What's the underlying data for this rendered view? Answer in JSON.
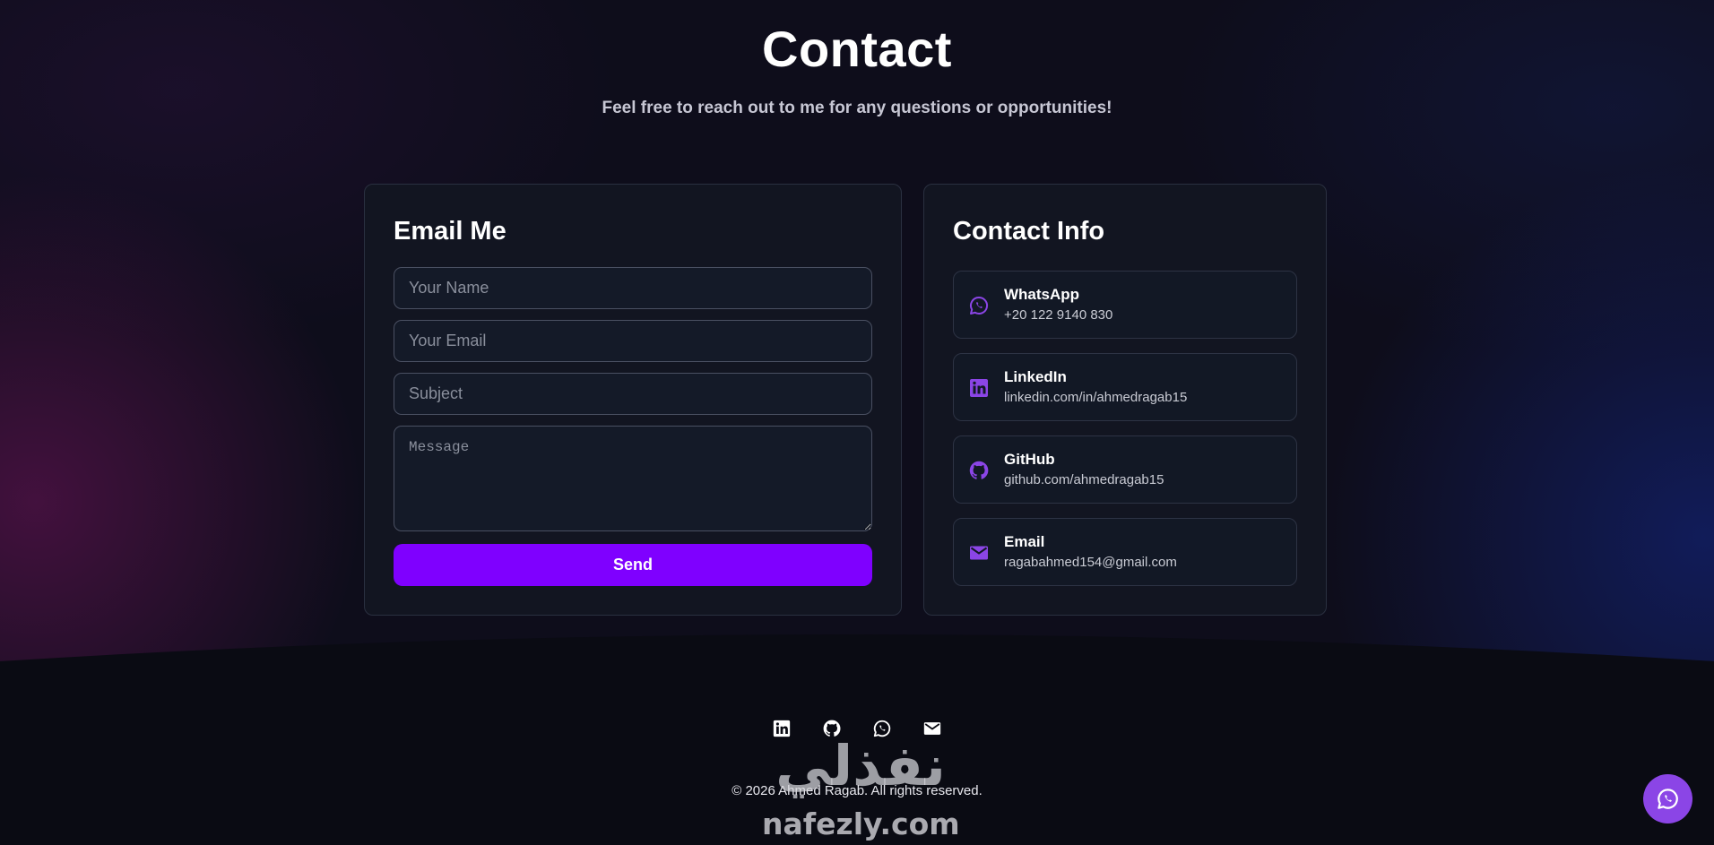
{
  "header": {
    "title": "Contact",
    "subtitle": "Feel free to reach out to me for any questions or opportunities!"
  },
  "email_form": {
    "title": "Email Me",
    "name_placeholder": "Your Name",
    "email_placeholder": "Your Email",
    "subject_placeholder": "Subject",
    "message_placeholder": "Message",
    "send_label": "Send"
  },
  "contact_info": {
    "title": "Contact Info",
    "items": [
      {
        "label": "WhatsApp",
        "value": "+20 122 9140 830",
        "icon": "whatsapp-icon"
      },
      {
        "label": "LinkedIn",
        "value": "linkedin.com/in/ahmedragab15",
        "icon": "linkedin-icon"
      },
      {
        "label": "GitHub",
        "value": "github.com/ahmedragab15",
        "icon": "github-icon"
      },
      {
        "label": "Email",
        "value": "ragabahmed154@gmail.com",
        "icon": "mail-icon"
      }
    ]
  },
  "footer": {
    "icons": [
      "linkedin-icon",
      "github-icon",
      "whatsapp-icon",
      "mail-icon"
    ],
    "copyright": "© 2026 Ahmed Ragab. All rights reserved."
  },
  "watermark": {
    "arabic": "نفذلي",
    "latin": "nafezly.com"
  },
  "floating_button": {
    "icon": "whatsapp-icon"
  },
  "colors": {
    "accent": "#7f00ff",
    "icon_accent": "#8b45e6",
    "background": "#0e0d1b",
    "card": "#121622"
  }
}
